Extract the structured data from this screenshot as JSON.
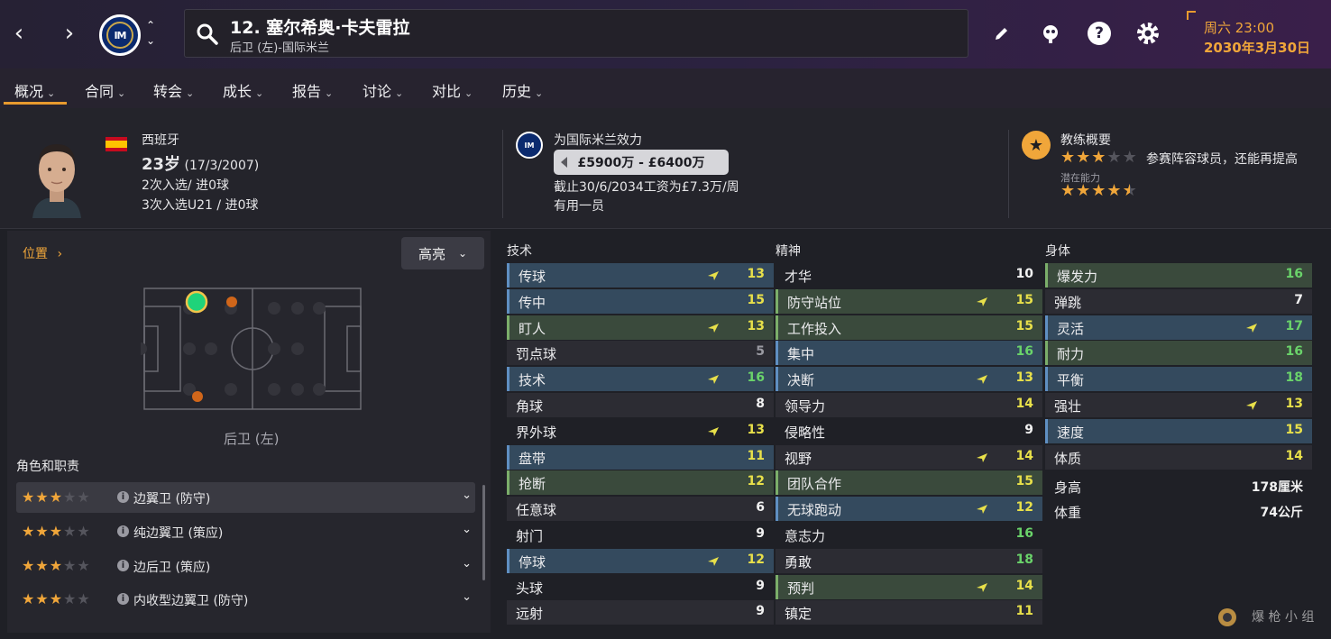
{
  "header": {
    "player_title": "12. 塞尔希奥·卡夫雷拉",
    "player_sub": "后卫 (左)-国际米兰",
    "date_line1": "周六 23:00",
    "date_line2": "2030年3月30日"
  },
  "tabs": [
    {
      "label": "概况"
    },
    {
      "label": "合同"
    },
    {
      "label": "转会"
    },
    {
      "label": "成长"
    },
    {
      "label": "报告"
    },
    {
      "label": "讨论"
    },
    {
      "label": "对比"
    },
    {
      "label": "历史"
    }
  ],
  "summary": {
    "nationality": "西班牙",
    "age": "23岁",
    "dob": "(17/3/2007)",
    "caps": "2次入选/ 进0球",
    "u21_caps": "3次入选U21 / 进0球",
    "club_line": "为国际米兰效力",
    "value": "£5900万 - £6400万",
    "contract": "截止30/6/2034工资为£7.3万/周",
    "squad_status": "有用一员",
    "coach_title": "教练概要",
    "coach_desc": "参赛阵容球员，还能再提高",
    "potential_label": "潜在能力",
    "current_ability_stars": 3,
    "potential_ability_stars": 4.5
  },
  "position": {
    "title": "位置",
    "highlight_button": "高亮",
    "label": "后卫 (左)"
  },
  "roles": {
    "title": "角色和职责",
    "items": [
      {
        "name": "边翼卫 (防守)",
        "stars": 3
      },
      {
        "name": "纯边翼卫 (策应)",
        "stars": 3
      },
      {
        "name": "边后卫 (策应)",
        "stars": 3
      },
      {
        "name": "内收型边翼卫 (防守)",
        "stars": 3
      }
    ]
  },
  "attributes": {
    "technical": {
      "title": "技术",
      "items": [
        {
          "name": "传球",
          "value": "13",
          "hl": "blue",
          "arrow": true,
          "color": "yellow"
        },
        {
          "name": "传中",
          "value": "15",
          "hl": "blue",
          "arrow": false,
          "color": "yellow"
        },
        {
          "name": "盯人",
          "value": "13",
          "hl": "green",
          "arrow": true,
          "color": "yellow"
        },
        {
          "name": "罚点球",
          "value": "5",
          "hl": "none",
          "arrow": false,
          "color": "grey"
        },
        {
          "name": "技术",
          "value": "16",
          "hl": "blue",
          "arrow": true,
          "color": "green"
        },
        {
          "name": "角球",
          "value": "8",
          "hl": "none",
          "arrow": false,
          "color": "white"
        },
        {
          "name": "界外球",
          "value": "13",
          "hl": "none",
          "arrow": true,
          "color": "yellow"
        },
        {
          "name": "盘带",
          "value": "11",
          "hl": "blue",
          "arrow": false,
          "color": "yellow"
        },
        {
          "name": "抢断",
          "value": "12",
          "hl": "green",
          "arrow": false,
          "color": "yellow"
        },
        {
          "name": "任意球",
          "value": "6",
          "hl": "none",
          "arrow": false,
          "color": "white"
        },
        {
          "name": "射门",
          "value": "9",
          "hl": "none",
          "arrow": false,
          "color": "white"
        },
        {
          "name": "停球",
          "value": "12",
          "hl": "blue",
          "arrow": true,
          "color": "yellow"
        },
        {
          "name": "头球",
          "value": "9",
          "hl": "none",
          "arrow": false,
          "color": "white"
        },
        {
          "name": "远射",
          "value": "9",
          "hl": "none",
          "arrow": false,
          "color": "white"
        }
      ]
    },
    "mental": {
      "title": "精神",
      "items": [
        {
          "name": "才华",
          "value": "10",
          "hl": "none",
          "arrow": false,
          "color": "white"
        },
        {
          "name": "防守站位",
          "value": "15",
          "hl": "green",
          "arrow": true,
          "color": "yellow"
        },
        {
          "name": "工作投入",
          "value": "15",
          "hl": "green",
          "arrow": false,
          "color": "yellow"
        },
        {
          "name": "集中",
          "value": "16",
          "hl": "blue",
          "arrow": false,
          "color": "green"
        },
        {
          "name": "决断",
          "value": "13",
          "hl": "blue",
          "arrow": true,
          "color": "yellow"
        },
        {
          "name": "领导力",
          "value": "14",
          "hl": "none",
          "arrow": false,
          "color": "yellow"
        },
        {
          "name": "侵略性",
          "value": "9",
          "hl": "none",
          "arrow": false,
          "color": "white"
        },
        {
          "name": "视野",
          "value": "14",
          "hl": "none",
          "arrow": true,
          "color": "yellow"
        },
        {
          "name": "团队合作",
          "value": "15",
          "hl": "green",
          "arrow": false,
          "color": "yellow"
        },
        {
          "name": "无球跑动",
          "value": "12",
          "hl": "blue",
          "arrow": true,
          "color": "yellow"
        },
        {
          "name": "意志力",
          "value": "16",
          "hl": "none",
          "arrow": false,
          "color": "green"
        },
        {
          "name": "勇敢",
          "value": "18",
          "hl": "none",
          "arrow": false,
          "color": "green"
        },
        {
          "name": "预判",
          "value": "14",
          "hl": "green",
          "arrow": true,
          "color": "yellow"
        },
        {
          "name": "镇定",
          "value": "11",
          "hl": "none",
          "arrow": false,
          "color": "yellow"
        }
      ]
    },
    "physical": {
      "title": "身体",
      "items": [
        {
          "name": "爆发力",
          "value": "16",
          "hl": "green",
          "arrow": false,
          "color": "green"
        },
        {
          "name": "弹跳",
          "value": "7",
          "hl": "none",
          "arrow": false,
          "color": "white"
        },
        {
          "name": "灵活",
          "value": "17",
          "hl": "blue",
          "arrow": true,
          "color": "green"
        },
        {
          "name": "耐力",
          "value": "16",
          "hl": "green",
          "arrow": false,
          "color": "green"
        },
        {
          "name": "平衡",
          "value": "18",
          "hl": "blue",
          "arrow": false,
          "color": "green"
        },
        {
          "name": "强壮",
          "value": "13",
          "hl": "none",
          "arrow": true,
          "color": "yellow"
        },
        {
          "name": "速度",
          "value": "15",
          "hl": "blue",
          "arrow": false,
          "color": "yellow"
        },
        {
          "name": "体质",
          "value": "14",
          "hl": "none",
          "arrow": false,
          "color": "yellow"
        }
      ],
      "height_label": "身高",
      "height_value": "178厘米",
      "weight_label": "体重",
      "weight_value": "74公斤"
    }
  },
  "watermark": "爆 枪 小 组"
}
